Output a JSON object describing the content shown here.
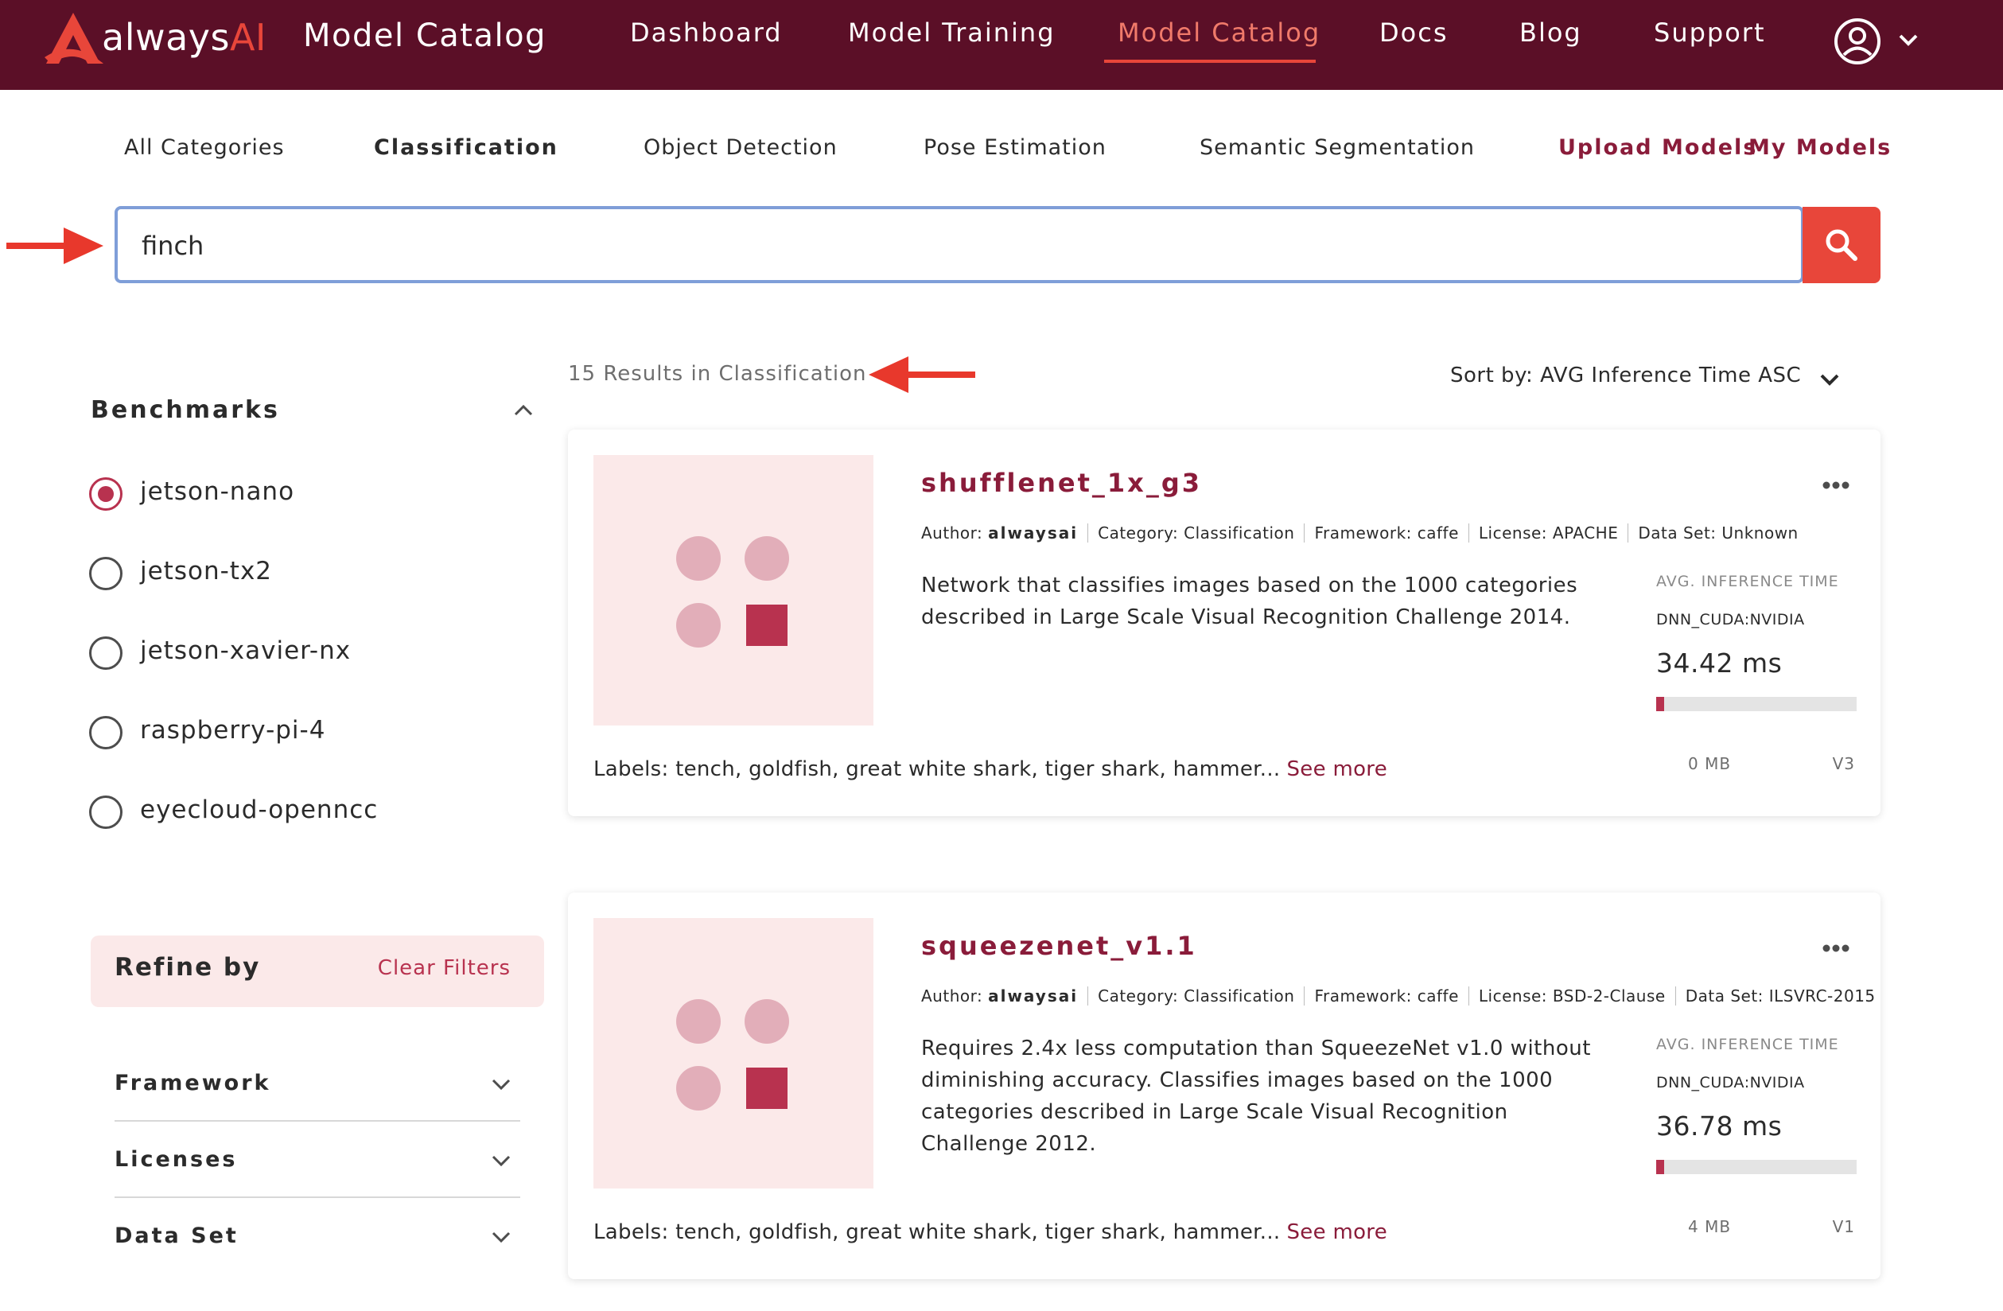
{
  "brand": {
    "logo_text_main": "always",
    "logo_text_accent": "AI",
    "app_title": "Model Catalog"
  },
  "colors": {
    "topbar": "#5b0f27",
    "accent": "#e8463a",
    "brand_text": "#8a1c3a",
    "pink_bg": "#fbe9e9"
  },
  "nav": {
    "items": [
      {
        "label": "Dashboard"
      },
      {
        "label": "Model Training"
      },
      {
        "label": "Model Catalog",
        "active": true
      },
      {
        "label": "Docs"
      },
      {
        "label": "Blog"
      },
      {
        "label": "Support"
      }
    ],
    "user_icon": "user-circle-icon"
  },
  "categories": {
    "items": [
      {
        "label": "All Categories"
      },
      {
        "label": "Classification",
        "active": true
      },
      {
        "label": "Object Detection"
      },
      {
        "label": "Pose Estimation"
      },
      {
        "label": "Semantic Segmentation"
      }
    ],
    "upload_label": "Upload Models",
    "my_models_label": "My Models"
  },
  "search": {
    "value": "finch",
    "icon": "search-icon"
  },
  "results": {
    "count_text": "15 Results in Classification",
    "sort_text": "Sort by: AVG Inference Time ASC"
  },
  "sidebar": {
    "benchmarks_title": "Benchmarks",
    "benchmarks": [
      {
        "label": "jetson-nano",
        "checked": true
      },
      {
        "label": "jetson-tx2",
        "checked": false
      },
      {
        "label": "jetson-xavier-nx",
        "checked": false
      },
      {
        "label": "raspberry-pi-4",
        "checked": false
      },
      {
        "label": "eyecloud-openncc",
        "checked": false
      }
    ],
    "refine_title": "Refine by",
    "clear_filters": "Clear Filters",
    "filters": [
      {
        "label": "Framework"
      },
      {
        "label": "Licenses"
      },
      {
        "label": "Data Set"
      }
    ]
  },
  "models": [
    {
      "name": "shufflenet_1x_g3",
      "author_label": "Author:",
      "author": "alwaysai",
      "category": "Category: Classification",
      "framework": "Framework: caffe",
      "license": "License: APACHE",
      "dataset": "Data Set: Unknown",
      "description": "Network that classifies images based on the 1000 categories described in Large Scale Visual Recognition Challenge 2014.",
      "inference_title": "AVG. INFERENCE TIME",
      "engine": "DNN_CUDA:NVIDIA",
      "inference_value": "34.42 ms",
      "inference_fill_percent": 4,
      "labels": "Labels: tench, goldfish, great white shark, tiger shark, hammer...",
      "see_more": "See more",
      "size": "0 MB",
      "version": "V3"
    },
    {
      "name": "squeezenet_v1.1",
      "author_label": "Author:",
      "author": "alwaysai",
      "category": "Category: Classification",
      "framework": "Framework: caffe",
      "license": "License: BSD-2-Clause",
      "dataset": "Data Set: ILSVRC-2015",
      "description": "Requires 2.4x less computation than SqueezeNet v1.0 without diminishing accuracy. Classifies images based on the 1000 categories described in Large Scale Visual Recognition Challenge 2012.",
      "inference_title": "AVG. INFERENCE TIME",
      "engine": "DNN_CUDA:NVIDIA",
      "inference_value": "36.78 ms",
      "inference_fill_percent": 4,
      "labels": "Labels: tench, goldfish, great white shark, tiger shark, hammer...",
      "see_more": "See more",
      "size": "4 MB",
      "version": "V1"
    }
  ]
}
